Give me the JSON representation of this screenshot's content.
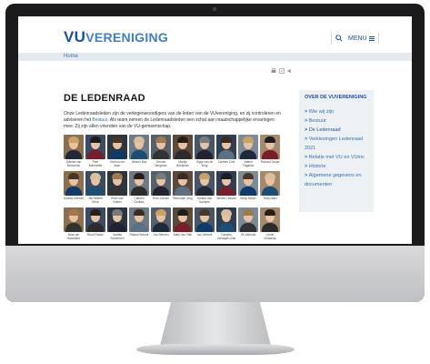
{
  "site": {
    "logo_main": "VU",
    "logo_rest": "VERENIGING",
    "menu_label": "MENU",
    "breadcrumb": "Home"
  },
  "page": {
    "title": "DE LEDENRAAD",
    "intro_part1": "Onze Ledenraadsleden zijn de vertegenwoordigers van de leden van de VUvereniging, en zij controleren en adviseren het ",
    "intro_link": "Bestuur",
    "intro_part2": ". Als team nemen de Ledenraadsleden een schat aan maatschappelijke ervaringen mee. Zij zijn allen vrienden van de VU-gemeenschap."
  },
  "members": [
    "Adeline van Bemmelel",
    "Peer Brimswitte",
    "Germon de Boer",
    "Wouter Bax",
    "Dennis Bergman",
    "Martijn Brinkman",
    "Gijsje van de Brug",
    "Carmen Crits",
    "Valerie Fagarda",
    "Richard Dorpe",
    "Andrea Drieses",
    "Jan Willem Erica",
    "Peter van Velden",
    "Carleen Grolkes",
    "Erno Jahnke",
    "Ramonde Jong",
    "Sandra van Kampen",
    "Menno Lekstra",
    "Nicky Meyer",
    "Tariq Nabil",
    "Nina van Haselland",
    "Ruud Ruben",
    "Josette Schimmen",
    "Roland Schuur",
    "Jan Stemen",
    "Mare van Vliet",
    "Jan Verkerk",
    "Caroline Verhagen-Dak",
    "Gil Verhulst",
    "Lester Verlaerap"
  ],
  "sidebar": {
    "title": "OVER DE VUVERENIGING",
    "items": [
      "Wie wij zijn",
      "Bestuur",
      "De Ledenraad",
      "Verkiezingen Ledenraad 2021",
      "Relatie met VU en VUmc",
      "Historie",
      "Algemene gegevens en documenten"
    ]
  },
  "colors": {
    "brand": "#1d4f9c",
    "link": "#2f6fba",
    "sidebar_bg": "#eef1f4"
  }
}
